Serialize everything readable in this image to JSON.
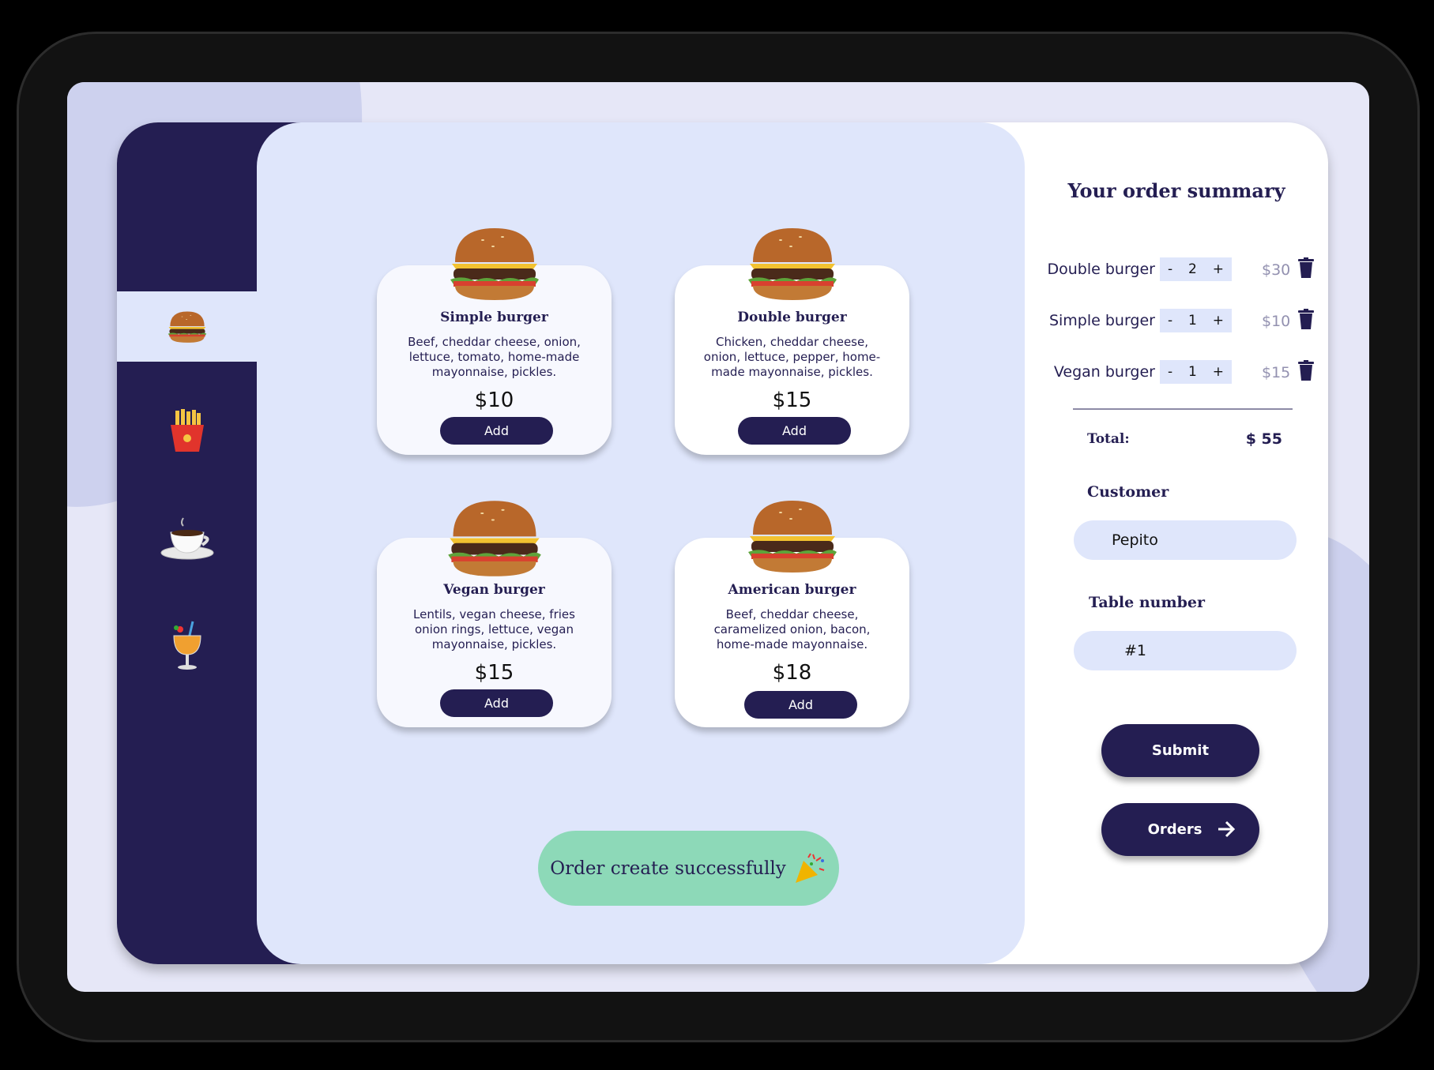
{
  "sidebar": {
    "items": [
      {
        "name": "burgers",
        "icon": "burger-icon",
        "active": true
      },
      {
        "name": "fries",
        "icon": "fries-icon",
        "active": false
      },
      {
        "name": "coffee",
        "icon": "coffee-icon",
        "active": false
      },
      {
        "name": "drinks",
        "icon": "cocktail-icon",
        "active": false
      }
    ]
  },
  "menu": {
    "items": [
      {
        "title": "Simple burger",
        "desc": "Beef, cheddar cheese, onion, lettuce, tomato, home-made mayonnaise, pickles.",
        "price": "$10",
        "button": "Add"
      },
      {
        "title": "Double burger",
        "desc": "Chicken, cheddar cheese, onion, lettuce, pepper, home-made mayonnaise, pickles.",
        "price": "$15",
        "button": "Add"
      },
      {
        "title": "Vegan burger",
        "desc": "Lentils, vegan cheese, fries onion rings, lettuce, vegan mayonnaise, pickles.",
        "price": "$15",
        "button": "Add"
      },
      {
        "title": "American burger",
        "desc": "Beef, cheddar cheese, caramelized onion, bacon, home-made mayonnaise.",
        "price": "$18",
        "button": "Add"
      }
    ]
  },
  "toast": {
    "text": "Order create successfully",
    "icon": "party-popper-icon"
  },
  "summary": {
    "title": "Your order summary",
    "items": [
      {
        "name": "Double burger",
        "qty": "2",
        "price": "$30"
      },
      {
        "name": "Simple burger",
        "qty": "1",
        "price": "$10"
      },
      {
        "name": "Vegan burger",
        "qty": "1",
        "price": "$15"
      }
    ],
    "minus": "-",
    "plus": "+",
    "total_label": "Total:",
    "total_value": "$ 55",
    "customer_label": "Customer",
    "customer_value": "Pepito",
    "table_label": "Table number",
    "table_value": "#1",
    "submit": "Submit",
    "orders": "Orders"
  },
  "colors": {
    "primary": "#241e52",
    "panel": "#dfe6fb",
    "toast": "#8dd9b8"
  }
}
